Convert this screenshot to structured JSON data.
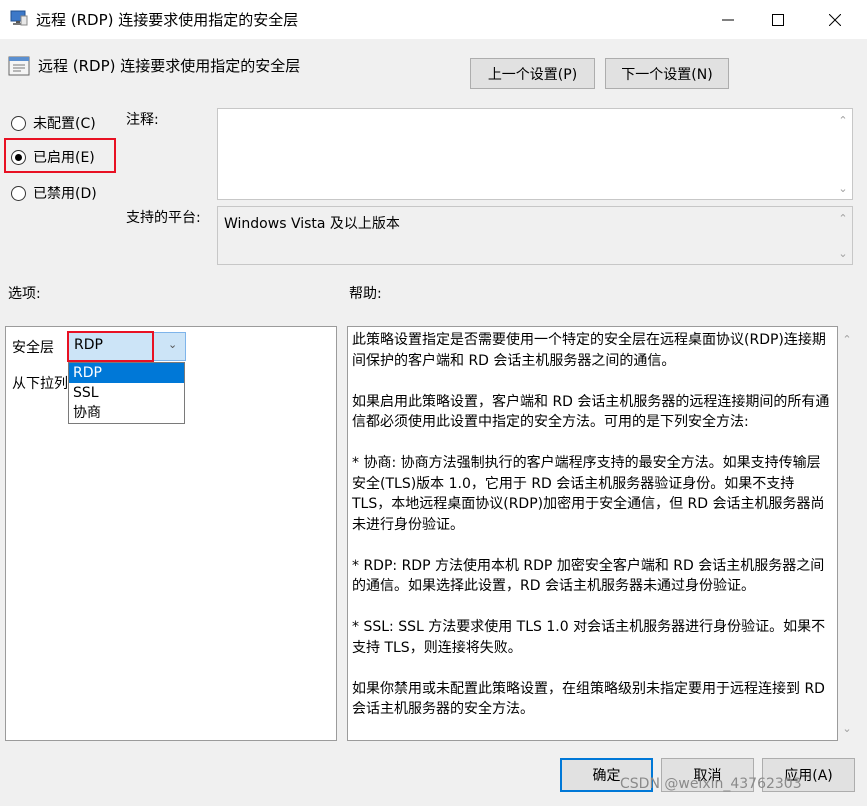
{
  "window": {
    "title": "远程 (RDP) 连接要求使用指定的安全层",
    "icons": {
      "app": "policy-monitor-icon",
      "minimize": "minimize-icon",
      "maximize": "maximize-icon",
      "close": "close-icon"
    }
  },
  "header": {
    "policy_title": "远程 (RDP) 连接要求使用指定的安全层",
    "prev_button": "上一个设置(P)",
    "next_button": "下一个设置(N)"
  },
  "state": {
    "options": [
      {
        "label": "未配置(C)",
        "checked": false
      },
      {
        "label": "已启用(E)",
        "checked": true
      },
      {
        "label": "已禁用(D)",
        "checked": false
      }
    ],
    "highlight_color": "#e81123"
  },
  "comment": {
    "label": "注释:",
    "value": ""
  },
  "platform": {
    "label": "支持的平台:",
    "value": "Windows Vista 及以上版本"
  },
  "sections": {
    "options_label": "选项:",
    "help_label": "帮助:"
  },
  "options_panel": {
    "security_layer_label": "安全层",
    "selected_value": "RDP",
    "partial_text": "从下拉列",
    "dropdown_options": [
      "RDP",
      "SSL",
      "协商"
    ]
  },
  "help": {
    "paragraphs": [
      "此策略设置指定是否需要使用一个特定的安全层在远程桌面协议(RDP)连接期间保护的客户端和 RD 会话主机服务器之间的通信。",
      "如果启用此策略设置，客户端和 RD 会话主机服务器的远程连接期间的所有通信都必须使用此设置中指定的安全方法。可用的是下列安全方法:",
      "* 协商: 协商方法强制执行的客户端程序支持的最安全方法。如果支持传输层安全(TLS)版本 1.0，它用于 RD 会话主机服务器验证身份。如果不支持 TLS，本地远程桌面协议(RDP)加密用于安全通信，但 RD 会话主机服务器尚未进行身份验证。",
      "* RDP: RDP 方法使用本机 RDP 加密安全客户端和 RD 会话主机服务器之间的通信。如果选择此设置，RD 会话主机服务器未通过身份验证。",
      "* SSL: SSL 方法要求使用 TLS 1.0 对会话主机服务器进行身份验证。如果不支持 TLS，则连接将失败。",
      "如果你禁用或未配置此策略设置，在组策略级别未指定要用于远程连接到 RD 会话主机服务器的安全方法。"
    ]
  },
  "footer": {
    "ok": "确定",
    "cancel": "取消",
    "apply": "应用(A)",
    "watermark": "CSDN @weixin_43762303"
  }
}
